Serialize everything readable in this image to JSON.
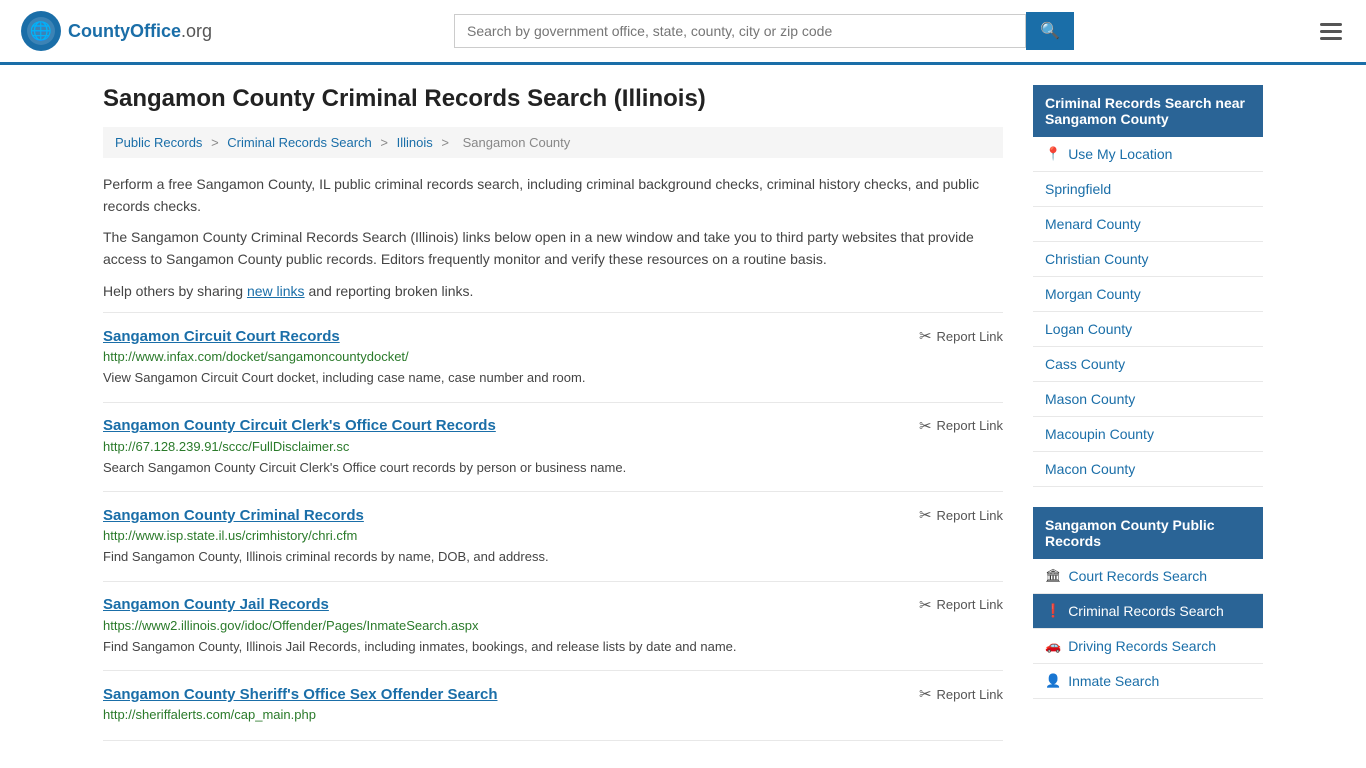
{
  "header": {
    "logo_text": "CountyOffice",
    "logo_suffix": ".org",
    "search_placeholder": "Search by government office, state, county, city or zip code"
  },
  "page": {
    "title": "Sangamon County Criminal Records Search (Illinois)",
    "breadcrumbs": [
      {
        "label": "Public Records",
        "href": "#"
      },
      {
        "label": "Criminal Records Search",
        "href": "#"
      },
      {
        "label": "Illinois",
        "href": "#"
      },
      {
        "label": "Sangamon County",
        "href": "#"
      }
    ],
    "desc1": "Perform a free Sangamon County, IL public criminal records search, including criminal background checks, criminal history checks, and public records checks.",
    "desc2": "The Sangamon County Criminal Records Search (Illinois) links below open in a new window and take you to third party websites that provide access to Sangamon County public records. Editors frequently monitor and verify these resources on a routine basis.",
    "desc3_prefix": "Help others by sharing ",
    "desc3_link": "new links",
    "desc3_suffix": " and reporting broken links.",
    "report_label": "Report Link"
  },
  "records": [
    {
      "title": "Sangamon Circuit Court Records",
      "url": "http://www.infax.com/docket/sangamoncountydocket/",
      "desc": "View Sangamon Circuit Court docket, including case name, case number and room."
    },
    {
      "title": "Sangamon County Circuit Clerk's Office Court Records",
      "url": "http://67.128.239.91/sccc/FullDisclaimer.sc",
      "desc": "Search Sangamon County Circuit Clerk's Office court records by person or business name."
    },
    {
      "title": "Sangamon County Criminal Records",
      "url": "http://www.isp.state.il.us/crimhistory/chri.cfm",
      "desc": "Find Sangamon County, Illinois criminal records by name, DOB, and address."
    },
    {
      "title": "Sangamon County Jail Records",
      "url": "https://www2.illinois.gov/idoc/Offender/Pages/InmateSearch.aspx",
      "desc": "Find Sangamon County, Illinois Jail Records, including inmates, bookings, and release lists by date and name."
    },
    {
      "title": "Sangamon County Sheriff's Office Sex Offender Search",
      "url": "http://sheriffalerts.com/cap_main.php",
      "desc": ""
    }
  ],
  "sidebar": {
    "nearby_header": "Criminal Records Search near Sangamon County",
    "nearby_items": [
      {
        "label": "Use My Location",
        "icon": "📍",
        "is_location": true
      },
      {
        "label": "Springfield",
        "icon": ""
      },
      {
        "label": "Menard County",
        "icon": ""
      },
      {
        "label": "Christian County",
        "icon": ""
      },
      {
        "label": "Morgan County",
        "icon": ""
      },
      {
        "label": "Logan County",
        "icon": ""
      },
      {
        "label": "Cass County",
        "icon": ""
      },
      {
        "label": "Mason County",
        "icon": ""
      },
      {
        "label": "Macoupin County",
        "icon": ""
      },
      {
        "label": "Macon County",
        "icon": ""
      }
    ],
    "public_records_header": "Sangamon County Public Records",
    "public_records_items": [
      {
        "label": "Court Records Search",
        "icon": "🏛",
        "active": false
      },
      {
        "label": "Criminal Records Search",
        "icon": "❗",
        "active": true
      },
      {
        "label": "Driving Records Search",
        "icon": "🚗",
        "active": false
      },
      {
        "label": "Inmate Search",
        "icon": "👤",
        "active": false
      }
    ]
  }
}
